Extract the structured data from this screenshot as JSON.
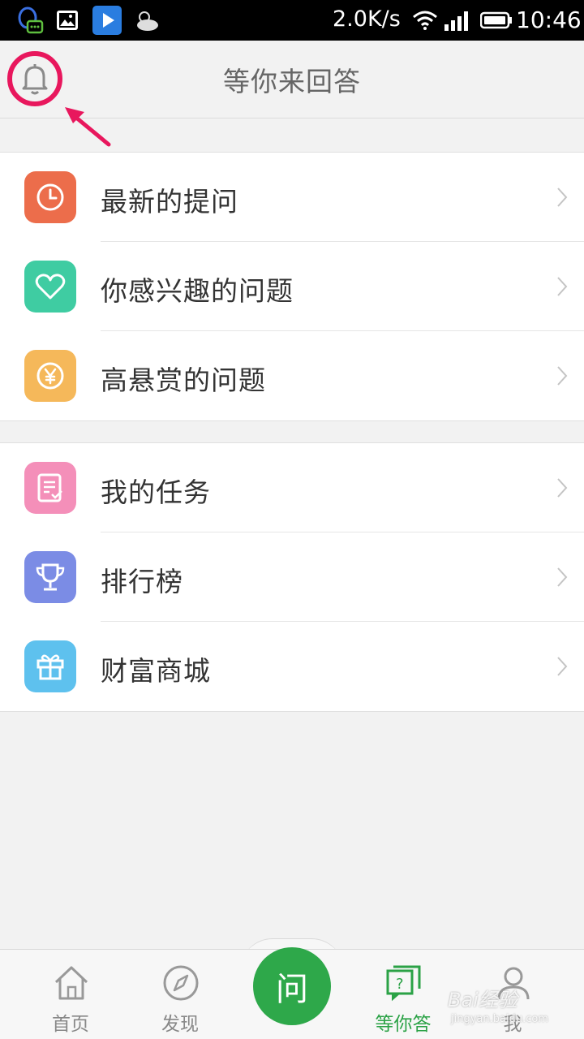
{
  "status_bar": {
    "speed": "2.0K/s",
    "time": "10:46"
  },
  "header": {
    "title": "等你来回答"
  },
  "group1": [
    {
      "label": "最新的提问",
      "icon": "clock-icon",
      "color": "#ec6d4b"
    },
    {
      "label": "你感兴趣的问题",
      "icon": "heart-icon",
      "color": "#3fcca2"
    },
    {
      "label": "高悬赏的问题",
      "icon": "yen-icon",
      "color": "#f5b85a"
    }
  ],
  "group2": [
    {
      "label": "我的任务",
      "icon": "task-icon",
      "color": "#f48fb9"
    },
    {
      "label": "排行榜",
      "icon": "trophy-icon",
      "color": "#7b8ce5"
    },
    {
      "label": "财富商城",
      "icon": "gift-icon",
      "color": "#5ec1ee"
    }
  ],
  "bottom_nav": {
    "home": "首页",
    "discover": "发现",
    "ask": "问",
    "answer": "等你答",
    "me": "我"
  },
  "watermark": {
    "brand": "Bai经验",
    "url": "jingyan.baidu.com"
  },
  "colors": {
    "accent_green": "#2ba246",
    "annotation_red": "#e8175d"
  }
}
